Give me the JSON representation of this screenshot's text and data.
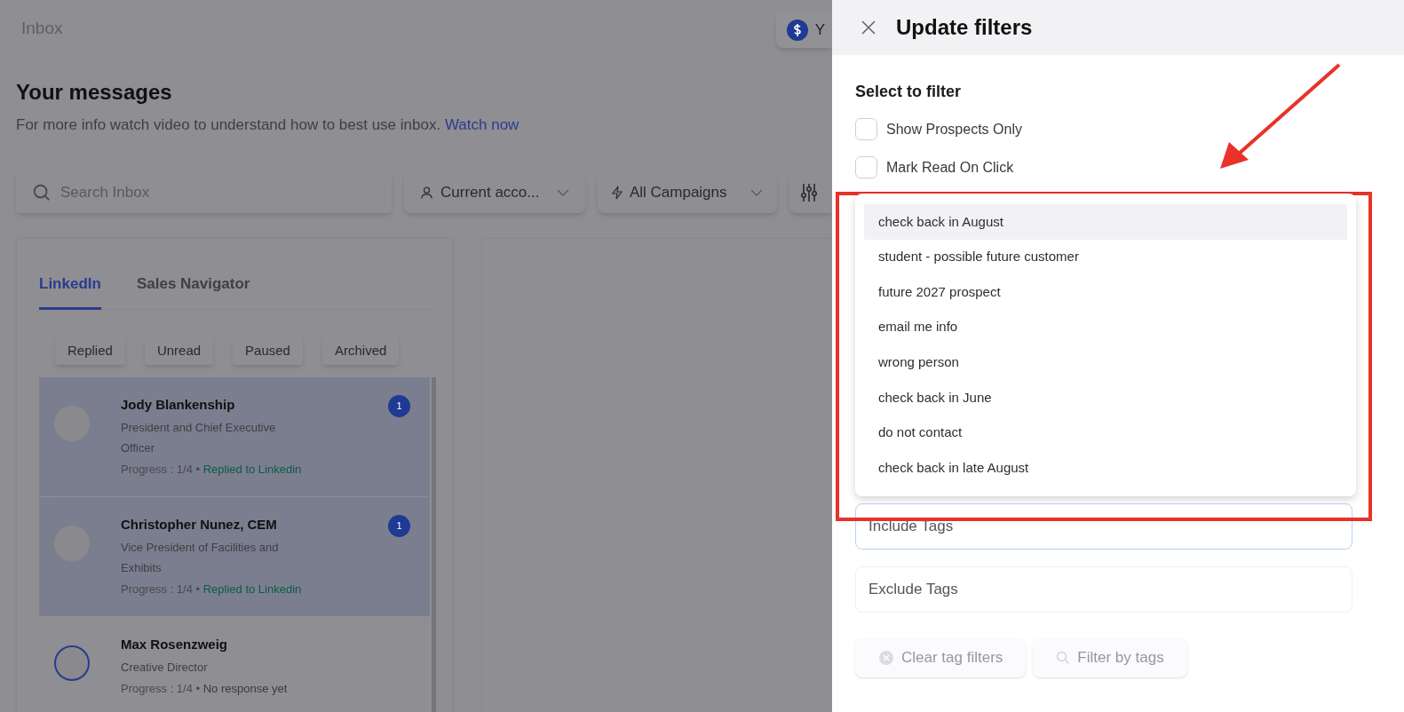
{
  "page": {
    "title": "Inbox",
    "credit_chip": {
      "label": "Y"
    },
    "heading": "Your messages",
    "intro": "For more info watch video to understand how to best use inbox.",
    "intro_link": "Watch now"
  },
  "toolbar": {
    "search": {
      "placeholder": "Search Inbox"
    },
    "account_select": "Current acco...",
    "campaign_select": "All Campaigns"
  },
  "tabs": [
    {
      "label": "LinkedIn",
      "selected": true
    },
    {
      "label": "Sales Navigator",
      "selected": false
    }
  ],
  "quick_filters": [
    "Replied",
    "Unread",
    "Paused",
    "Archived"
  ],
  "messages": [
    {
      "name": "Jody Blankenship",
      "title": "President and Chief Executive Officer",
      "progress": "Progress : 1/4",
      "separator": "•",
      "status": "Replied to Linkedin",
      "replied": true,
      "unread": "1",
      "selected": true
    },
    {
      "name": "Christopher Nunez, CEM",
      "title": "Vice President of Facilities and Exhibits",
      "progress": "Progress : 1/4",
      "separator": "•",
      "status": "Replied to Linkedin",
      "replied": true,
      "unread": "1",
      "selected": true
    },
    {
      "name": "Max Rosenzweig",
      "title": "Creative Director",
      "progress": "Progress : 1/4",
      "separator": "•",
      "status": "No response yet",
      "replied": false,
      "selected": false
    }
  ],
  "filter_panel": {
    "title": "Update filters",
    "section": "Select to filter",
    "options": [
      {
        "label": "Show Prospects Only",
        "checked": false
      },
      {
        "label": "Mark Read On Click",
        "checked": false
      }
    ],
    "tag_menu": [
      {
        "label": "check back in August",
        "selected": true
      },
      {
        "label": "student - possible future customer",
        "selected": false
      },
      {
        "label": "future 2027 prospect",
        "selected": false
      },
      {
        "label": "email me info",
        "selected": false
      },
      {
        "label": "wrong person",
        "selected": false
      },
      {
        "label": "check back in June",
        "selected": false
      },
      {
        "label": "do not contact",
        "selected": false
      },
      {
        "label": "check back in late August",
        "selected": false
      }
    ],
    "include_tags": {
      "placeholder": "Include Tags"
    },
    "exclude_tags": {
      "placeholder": "Exclude Tags"
    },
    "buttons": [
      "Clear tag filters",
      "Filter by tags"
    ]
  }
}
